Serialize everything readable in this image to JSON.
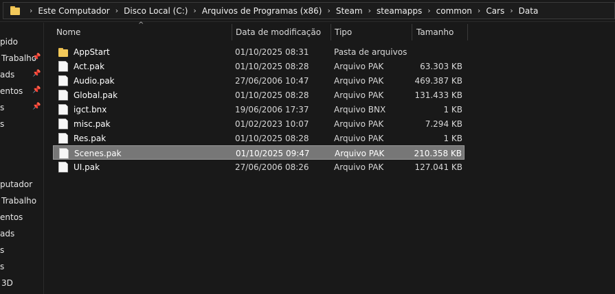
{
  "breadcrumb": [
    "Este Computador",
    "Disco Local (C:)",
    "Arquivos de Programas (x86)",
    "Steam",
    "steamapps",
    "common",
    "Cars",
    "Data"
  ],
  "sidebar": {
    "items": [
      {
        "label": "pido",
        "pinned": false
      },
      {
        "label": "Trabalho",
        "pinned": true
      },
      {
        "label": "ads",
        "pinned": true
      },
      {
        "label": "entos",
        "pinned": true
      },
      {
        "label": "s",
        "pinned": true
      },
      {
        "label": "s",
        "pinned": false
      },
      {
        "label": "putador",
        "pinned": false
      },
      {
        "label": "Trabalho",
        "pinned": false
      },
      {
        "label": "entos",
        "pinned": false
      },
      {
        "label": "ads",
        "pinned": false
      },
      {
        "label": "s",
        "pinned": false
      },
      {
        "label": "s",
        "pinned": false
      },
      {
        "label": "3D",
        "pinned": false
      }
    ]
  },
  "columns": {
    "name": "Nome",
    "date": "Data de modificação",
    "type": "Tipo",
    "size": "Tamanho"
  },
  "files": [
    {
      "name": "AppStart",
      "date": "01/10/2025 08:31",
      "type": "Pasta de arquivos",
      "size": "",
      "icon": "folder-icon"
    },
    {
      "name": "Act.pak",
      "date": "01/10/2025 08:28",
      "type": "Arquivo PAK",
      "size": "63.303 KB",
      "icon": "file-icon"
    },
    {
      "name": "Audio.pak",
      "date": "27/06/2006 10:47",
      "type": "Arquivo PAK",
      "size": "469.387 KB",
      "icon": "file-icon"
    },
    {
      "name": "Global.pak",
      "date": "01/10/2025 08:28",
      "type": "Arquivo PAK",
      "size": "131.433 KB",
      "icon": "file-icon"
    },
    {
      "name": "igct.bnx",
      "date": "19/06/2006 17:37",
      "type": "Arquivo BNX",
      "size": "1 KB",
      "icon": "file-icon"
    },
    {
      "name": "misc.pak",
      "date": "01/02/2023 10:07",
      "type": "Arquivo PAK",
      "size": "7.294 KB",
      "icon": "file-icon"
    },
    {
      "name": "Res.pak",
      "date": "01/10/2025 08:28",
      "type": "Arquivo PAK",
      "size": "1 KB",
      "icon": "file-icon"
    },
    {
      "name": "Scenes.pak",
      "date": "01/10/2025 09:47",
      "type": "Arquivo PAK",
      "size": "210.358 KB",
      "icon": "file-icon",
      "selected": true
    },
    {
      "name": "UI.pak",
      "date": "27/06/2006 08:26",
      "type": "Arquivo PAK",
      "size": "127.041 KB",
      "icon": "file-icon"
    }
  ]
}
